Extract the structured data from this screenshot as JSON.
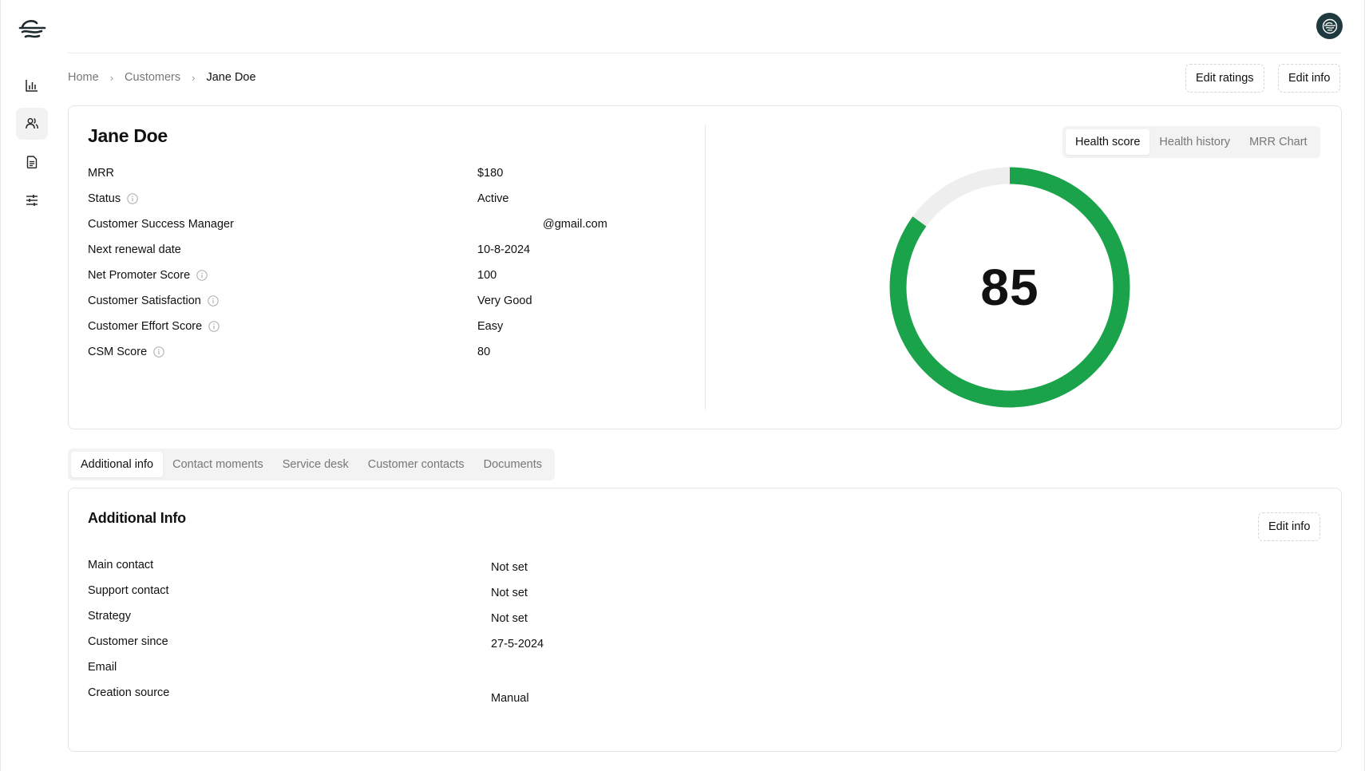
{
  "app": {
    "logo_icon": "waves-logo-icon",
    "avatar_icon": "waves-logo-icon"
  },
  "sidebar": {
    "items": [
      {
        "name": "analytics",
        "icon": "bar-chart-icon",
        "active": false
      },
      {
        "name": "customers",
        "icon": "users-icon",
        "active": true
      },
      {
        "name": "documents",
        "icon": "document-icon",
        "active": false
      },
      {
        "name": "settings",
        "icon": "sliders-icon",
        "active": false
      }
    ]
  },
  "breadcrumb": {
    "items": [
      "Home",
      "Customers",
      "Jane Doe"
    ],
    "separator": "›"
  },
  "header_actions": {
    "edit_ratings": "Edit ratings",
    "edit_info": "Edit info"
  },
  "customer": {
    "name": "Jane Doe",
    "fields": [
      {
        "label": "MRR",
        "value": "$180",
        "info": false
      },
      {
        "label": "Status",
        "value": "Active",
        "info": true
      },
      {
        "label": "Customer Success Manager",
        "value": "@gmail.com",
        "info": false
      },
      {
        "label": "Next renewal date",
        "value": "10-8-2024",
        "info": false
      },
      {
        "label": "Net Promoter Score",
        "value": "100",
        "info": true
      },
      {
        "label": "Customer Satisfaction",
        "value": "Very Good",
        "info": true
      },
      {
        "label": "Customer Effort Score",
        "value": "Easy",
        "info": true
      },
      {
        "label": "CSM Score",
        "value": "80",
        "info": true
      }
    ]
  },
  "health": {
    "tabs": [
      {
        "label": "Health score",
        "active": true
      },
      {
        "label": "Health history",
        "active": false
      },
      {
        "label": "MRR Chart",
        "active": false
      }
    ],
    "score": "85",
    "score_percent": 85,
    "colors": {
      "fill": "#1aa34a",
      "track": "#eeeeee"
    }
  },
  "detail_tabs": [
    {
      "label": "Additional info",
      "active": true
    },
    {
      "label": "Contact moments",
      "active": false
    },
    {
      "label": "Service desk",
      "active": false
    },
    {
      "label": "Customer contacts",
      "active": false
    },
    {
      "label": "Documents",
      "active": false
    }
  ],
  "additional_info": {
    "title": "Additional Info",
    "edit_label": "Edit info",
    "rows": [
      {
        "label": "Main contact",
        "value": "Not set"
      },
      {
        "label": "Support contact",
        "value": "Not set"
      },
      {
        "label": "Strategy",
        "value": "Not set"
      },
      {
        "label": "Customer since",
        "value": "27-5-2024"
      },
      {
        "label": "Email",
        "value": ""
      },
      {
        "label": "Creation source",
        "value": "Manual"
      }
    ]
  }
}
